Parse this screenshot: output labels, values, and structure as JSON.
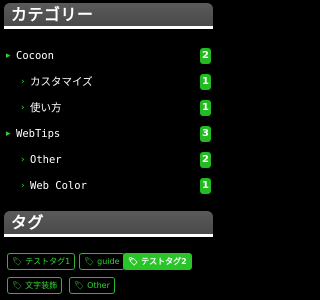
{
  "category_widget": {
    "title": "カテゴリー",
    "items": [
      {
        "label": "Cocoon",
        "count": "2"
      },
      {
        "label": "カスタマイズ",
        "count": "1"
      },
      {
        "label": "使い方",
        "count": "1"
      },
      {
        "label": "WebTips",
        "count": "3"
      },
      {
        "label": "Other",
        "count": "2"
      },
      {
        "label": "Web Color",
        "count": "1"
      }
    ]
  },
  "tag_widget": {
    "title": "タグ",
    "tags": [
      {
        "label": "テストタグ1"
      },
      {
        "label": "guide"
      },
      {
        "label": "テストタグ2"
      },
      {
        "label": "文字装飾"
      },
      {
        "label": "Other"
      }
    ]
  },
  "colors": {
    "accent_green": "#28c428",
    "title_bar": "#4f4f4f",
    "background": "#000000"
  },
  "icons": {
    "category_arrow": "chevron-right-icon",
    "tag": "tag-icon"
  }
}
